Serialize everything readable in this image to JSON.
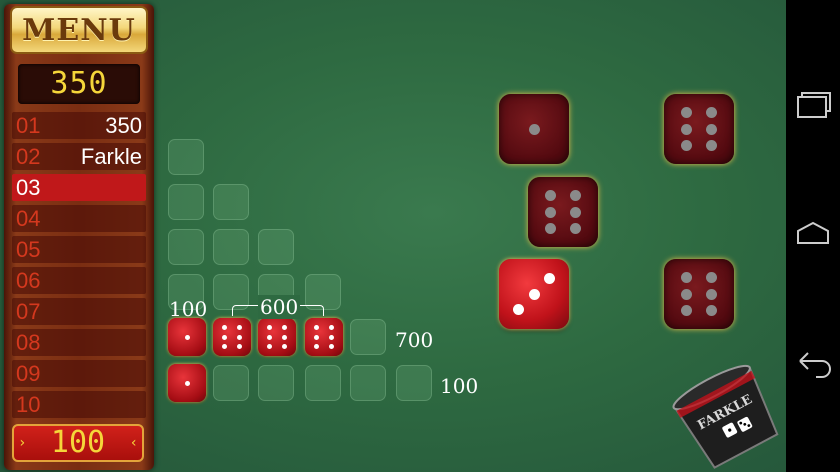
{
  "menu_label": "MENU",
  "total_score": "350",
  "rounds": [
    {
      "num": "01",
      "score": "350"
    },
    {
      "num": "02",
      "score": "Farkle"
    },
    {
      "num": "03",
      "score": ""
    },
    {
      "num": "04",
      "score": ""
    },
    {
      "num": "05",
      "score": ""
    },
    {
      "num": "06",
      "score": ""
    },
    {
      "num": "07",
      "score": ""
    },
    {
      "num": "08",
      "score": ""
    },
    {
      "num": "09",
      "score": ""
    },
    {
      "num": "10",
      "score": ""
    }
  ],
  "active_round": 2,
  "turn_score": "100",
  "labels": {
    "row4_left": "100",
    "row4_bracket": "600",
    "row4_right": "700",
    "row5_right": "100"
  },
  "cup_label": "FARKLE",
  "colors": {
    "felt": "#2e6a41",
    "die_red": "#c0121a",
    "accent_gold": "#f5d63a"
  },
  "icons": {
    "recent": "recent-apps-icon",
    "home": "home-icon",
    "back": "back-icon"
  }
}
